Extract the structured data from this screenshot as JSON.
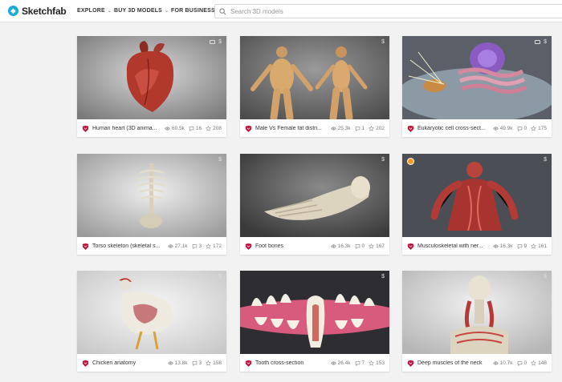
{
  "header": {
    "logo_text": "Sketchfab",
    "nav": [
      {
        "label": "EXPLORE"
      },
      {
        "label": "BUY 3D MODELS"
      },
      {
        "label": "FOR BUSINESS"
      }
    ],
    "search_placeholder": "Search 3D models"
  },
  "colors": {
    "brand": "#1caad9",
    "staff_pick": "#f59a23",
    "avatar": "#c0123c"
  },
  "cards": [
    {
      "title": "Human heart (3D anima...",
      "views": "60.5k",
      "comments": "16",
      "likes": "208",
      "badges": "vr,$"
    },
    {
      "title": "Male Vs Female fat distri...",
      "views": "25.3k",
      "comments": "1",
      "likes": "202",
      "badges": "$"
    },
    {
      "title": "Eukaryotic cell cross-sect...",
      "views": "49.9k",
      "comments": "0",
      "likes": "175",
      "badges": "vr,$"
    },
    {
      "title": "Torso skeleton (skeletal s...",
      "views": "27.1k",
      "comments": "3",
      "likes": "172",
      "badges": "$"
    },
    {
      "title": "Foot bones",
      "views": "16.3k",
      "comments": "0",
      "likes": "167",
      "badges": "$"
    },
    {
      "title": "Musculoskeletal with ner...",
      "views": "16.3k",
      "comments": "9",
      "likes": "161",
      "badges": "$"
    },
    {
      "title": "Chicken anatomy",
      "views": "13.8k",
      "comments": "3",
      "likes": "158",
      "badges": "$"
    },
    {
      "title": "Tooth cross-section",
      "views": "26.4k",
      "comments": "7",
      "likes": "153",
      "badges": "$"
    },
    {
      "title": "Deep muscles of the neck",
      "views": "10.7k",
      "comments": "0",
      "likes": "148",
      "badges": "$"
    }
  ]
}
